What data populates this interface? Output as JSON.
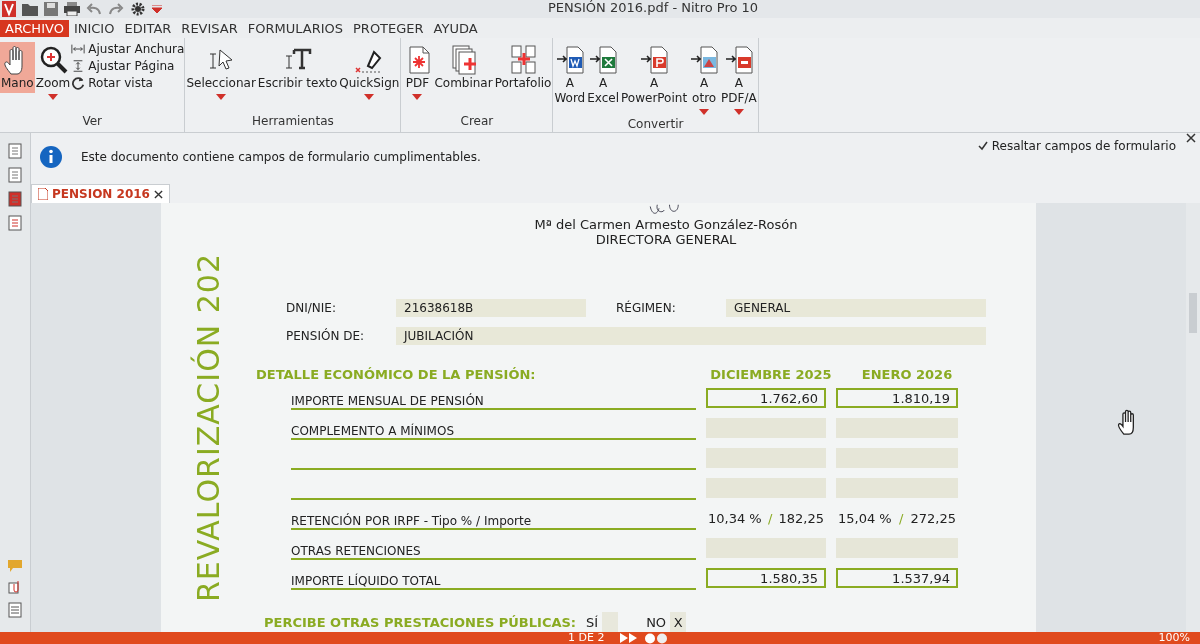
{
  "window": {
    "title": "PENSIÓN 2016.pdf - Nitro Pro 10"
  },
  "menu": [
    {
      "label": "ARCHIVO",
      "selected": true
    },
    {
      "label": "INICIO",
      "selected": false
    },
    {
      "label": "EDITAR",
      "selected": false
    },
    {
      "label": "REVISAR",
      "selected": false
    },
    {
      "label": "FORMULARIOS",
      "selected": false
    },
    {
      "label": "PROTEGER",
      "selected": false
    },
    {
      "label": "AYUDA",
      "selected": false
    }
  ],
  "ribbon": [
    {
      "label": "Ver",
      "tools": [
        {
          "kind": "hand",
          "label": "Mano",
          "selected": true,
          "dropdown": false
        },
        {
          "kind": "zoom",
          "label": "Zoom",
          "selected": false,
          "dropdown": true
        },
        {
          "kind": "fit-width",
          "label": "Ajustar Anchura"
        },
        {
          "kind": "fit-page",
          "label": "Ajustar Página"
        },
        {
          "kind": "rotate",
          "label": "Rotar vista"
        }
      ]
    },
    {
      "label": "Herramientas",
      "tools": [
        {
          "kind": "select",
          "label": "Seleccionar",
          "selected": false,
          "dropdown": true
        },
        {
          "kind": "type",
          "label": "Escribir texto",
          "selected": false,
          "dropdown": false
        },
        {
          "kind": "sign",
          "label": "QuickSign",
          "selected": false,
          "dropdown": true
        }
      ]
    },
    {
      "label": "Crear",
      "tools": [
        {
          "kind": "pdf",
          "label": "PDF",
          "selected": false,
          "dropdown": true
        },
        {
          "kind": "combine",
          "label": "Combinar",
          "selected": false,
          "dropdown": false
        },
        {
          "kind": "portfolio",
          "label": "Portafolio",
          "selected": false,
          "dropdown": false
        }
      ]
    },
    {
      "label": "Convertir",
      "tools": [
        {
          "kind": "word",
          "top": "A",
          "label": "Word",
          "selected": false,
          "dropdown": false
        },
        {
          "kind": "excel",
          "top": "A",
          "label": "Excel",
          "selected": false,
          "dropdown": false
        },
        {
          "kind": "ppt",
          "top": "A",
          "label": "PowerPoint",
          "selected": false,
          "dropdown": false
        },
        {
          "kind": "other",
          "top": "A",
          "label": "otro",
          "selected": false,
          "dropdown": true
        },
        {
          "kind": "pdfa",
          "top": "A",
          "label": "PDF/A",
          "selected": false,
          "dropdown": true
        }
      ]
    }
  ],
  "info_bar": {
    "message": "Este documento contiene campos de formulario cumplimentables.",
    "highlight": {
      "label": "Resaltar campos de formulario",
      "checked": true
    }
  },
  "tabs": [
    {
      "label": "PENSION 2016",
      "selected": true
    }
  ],
  "document": {
    "side_title": "REVALORIZACIÓN 202",
    "signer_name": "Mª del Carmen Armesto González-Rosón",
    "signer_title": "DIRECTORA GENERAL",
    "fields": [
      {
        "label": "DNI/NIE:",
        "value": "21638618B"
      },
      {
        "label": "RÉGIMEN:",
        "value": "GENERAL"
      },
      {
        "label": "PENSIÓN DE:",
        "value": "JUBILACIÓN"
      }
    ],
    "section_title": "DETALLE ECONÓMICO DE LA PENSIÓN:",
    "columns": [
      "DICIEMBRE 2025",
      "ENERO 2026"
    ],
    "rows": [
      {
        "kind": "boxed",
        "label": "IMPORTE MENSUAL DE PENSIÓN",
        "values": [
          "1.762,60",
          "1.810,19"
        ]
      },
      {
        "kind": "empty",
        "label": "COMPLEMENTO A MÍNIMOS"
      },
      {
        "kind": "empty"
      },
      {
        "kind": "empty"
      },
      {
        "kind": "rate",
        "label": "RETENCIÓN POR IRPF - Tipo % / Importe",
        "values": [
          {
            "rate": "10,34 %",
            "separator": "/",
            "amount": "182,25"
          },
          {
            "rate": "15,04 %",
            "separator": "/",
            "amount": "272,25"
          }
        ]
      },
      {
        "kind": "empty",
        "label": "OTRAS RETENCIONES"
      },
      {
        "kind": "boxed",
        "label": "IMPORTE LÍQUIDO TOTAL",
        "values": [
          "1.580,35",
          "1.537,94"
        ]
      }
    ],
    "question": {
      "label": "PERCIBE OTRAS PRESTACIONES PÚBLICAS:",
      "options": [
        {
          "label": "SÍ"
        },
        {
          "label": "NO",
          "value": "X"
        }
      ]
    }
  },
  "status_bar": {
    "page": "1 DE 2",
    "zoom": "100%"
  }
}
